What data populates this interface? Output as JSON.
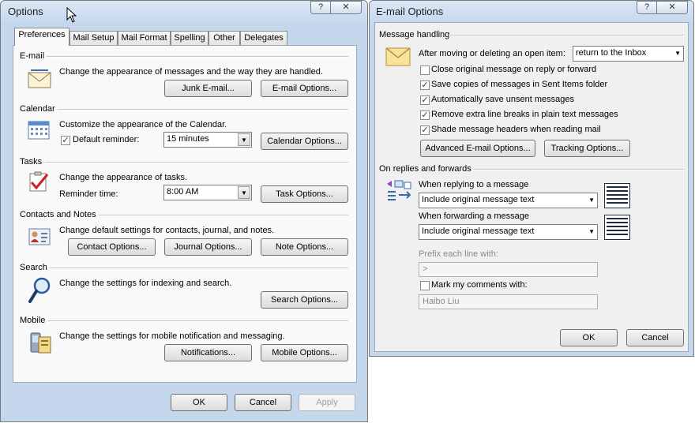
{
  "options_window": {
    "title": "Options",
    "help_glyph": "?",
    "close_glyph": "✕",
    "tabs": [
      {
        "label": "Preferences",
        "active": true
      },
      {
        "label": "Mail Setup",
        "active": false
      },
      {
        "label": "Mail Format",
        "active": false
      },
      {
        "label": "Spelling",
        "active": false
      },
      {
        "label": "Other",
        "active": false
      },
      {
        "label": "Delegates",
        "active": false
      }
    ],
    "sections": {
      "email": {
        "label": "E-mail",
        "icon": "envelope-icon",
        "description": "Change the appearance of messages and the way they are handled.",
        "junk_button": "Junk E-mail...",
        "options_button": "E-mail Options..."
      },
      "calendar": {
        "label": "Calendar",
        "icon": "calendar-icon",
        "description": "Customize the appearance of the Calendar.",
        "reminder_label": "Default reminder:",
        "reminder_checked": true,
        "reminder_value": "15 minutes",
        "options_button": "Calendar Options..."
      },
      "tasks": {
        "label": "Tasks",
        "icon": "task-checkmark-icon",
        "description": "Change the appearance of tasks.",
        "reminder_label": "Reminder time:",
        "reminder_value": "8:00 AM",
        "options_button": "Task Options..."
      },
      "contacts": {
        "label": "Contacts and Notes",
        "icon": "contact-card-icon",
        "description": "Change default settings for contacts, journal, and notes.",
        "contact_button": "Contact Options...",
        "journal_button": "Journal Options...",
        "note_button": "Note Options..."
      },
      "search": {
        "label": "Search",
        "icon": "magnifier-icon",
        "description": "Change the settings for indexing and search.",
        "options_button": "Search Options..."
      },
      "mobile": {
        "label": "Mobile",
        "icon": "mobile-device-icon",
        "description": "Change the settings for mobile notification and messaging.",
        "notifications_button": "Notifications...",
        "options_button": "Mobile Options..."
      }
    },
    "footer": {
      "ok": "OK",
      "cancel": "Cancel",
      "apply": "Apply"
    }
  },
  "email_options_window": {
    "title": "E-mail Options",
    "help_glyph": "?",
    "close_glyph": "✕",
    "message_handling": {
      "label": "Message handling",
      "after_moving_label": "After moving or deleting an open item:",
      "after_moving_value": "return to the Inbox",
      "checkboxes": [
        {
          "label": "Close original message on reply or forward",
          "checked": false
        },
        {
          "label": "Save copies of messages in Sent Items folder",
          "checked": true
        },
        {
          "label": "Automatically save unsent messages",
          "checked": true
        },
        {
          "label": "Remove extra line breaks in plain text messages",
          "checked": true
        },
        {
          "label": "Shade message headers when reading mail",
          "checked": true
        }
      ],
      "advanced_button": "Advanced E-mail Options...",
      "tracking_button": "Tracking Options..."
    },
    "replies": {
      "label": "On replies and forwards",
      "reply_label": "When replying to a message",
      "reply_value": "Include original message text",
      "forward_label": "When forwarding a message",
      "forward_value": "Include original message text",
      "prefix_label": "Prefix each line with:",
      "prefix_value": ">",
      "mark_label": "Mark my comments with:",
      "mark_checked": false,
      "mark_value": "Haibo Liu"
    },
    "footer": {
      "ok": "OK",
      "cancel": "Cancel"
    }
  },
  "glyphs": {
    "check": "✓",
    "dropdown": "▼"
  },
  "colors": {
    "title_bar": "#c6d8ee",
    "client": "#f0f0f0",
    "accent": "#1d3b6b"
  }
}
